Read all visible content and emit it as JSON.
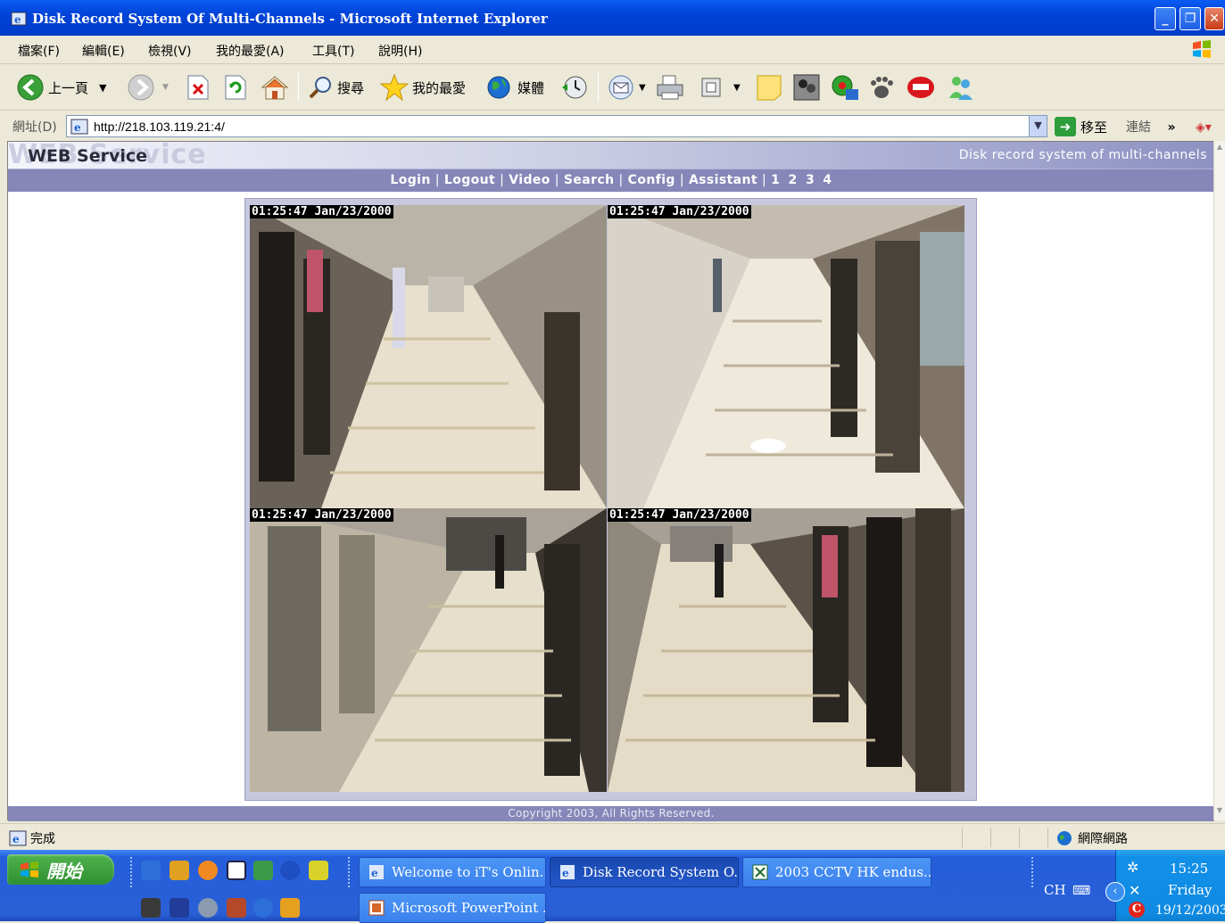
{
  "window": {
    "title": "Disk Record System Of Multi-Channels - Microsoft Internet Explorer",
    "minimize": "_",
    "restore": "❐",
    "close": "✕"
  },
  "menu": {
    "items": [
      "檔案(F)",
      "編輯(E)",
      "檢視(V)",
      "我的最愛(A)",
      "工具(T)",
      "說明(H)"
    ]
  },
  "toolbar": {
    "back_label": "上一頁",
    "search_label": "搜尋",
    "favorites_label": "我的最愛",
    "media_label": "媒體"
  },
  "address": {
    "label": "網址(D)",
    "url": "http://218.103.119.21:4/",
    "go_label": "移至",
    "links_label": "連結",
    "links_more": "»"
  },
  "page": {
    "banner_ghost": "WEB Service",
    "banner_brand": "WEB Service",
    "tagline": "Disk record system of multi-channels",
    "nav": {
      "login": "Login",
      "logout": "Logout",
      "video": "Video",
      "search": "Search",
      "config": "Config",
      "assistant": "Assistant",
      "pages": [
        "1",
        "2",
        "3",
        "4"
      ]
    },
    "cameras": [
      {
        "timestamp": "01:25:47 Jan/23/2000"
      },
      {
        "timestamp": "01:25:47 Jan/23/2000"
      },
      {
        "timestamp": "01:25:47 Jan/23/2000"
      },
      {
        "timestamp": "01:25:47 Jan/23/2000"
      }
    ],
    "footer": "Copyright 2003,  All Rights Reserved."
  },
  "status": {
    "text": "完成",
    "zone": "網際網路"
  },
  "taskbar": {
    "start_label": "開始",
    "buttons": [
      {
        "label": "Welcome to iT's Onlin...",
        "active": false
      },
      {
        "label": "Disk Record System O...",
        "active": true
      },
      {
        "label": "2003 CCTV HK endus...",
        "active": false
      },
      {
        "label": "Microsoft PowerPoint ...",
        "active": false
      }
    ],
    "language": "CH",
    "time": "15:25",
    "day": "Friday",
    "date": "19/12/2003"
  },
  "colors": {
    "title_bar": "#0043d8",
    "nav_bar": "#8687b8",
    "taskbar": "#245edb",
    "start_button": "#2f8f2f"
  }
}
